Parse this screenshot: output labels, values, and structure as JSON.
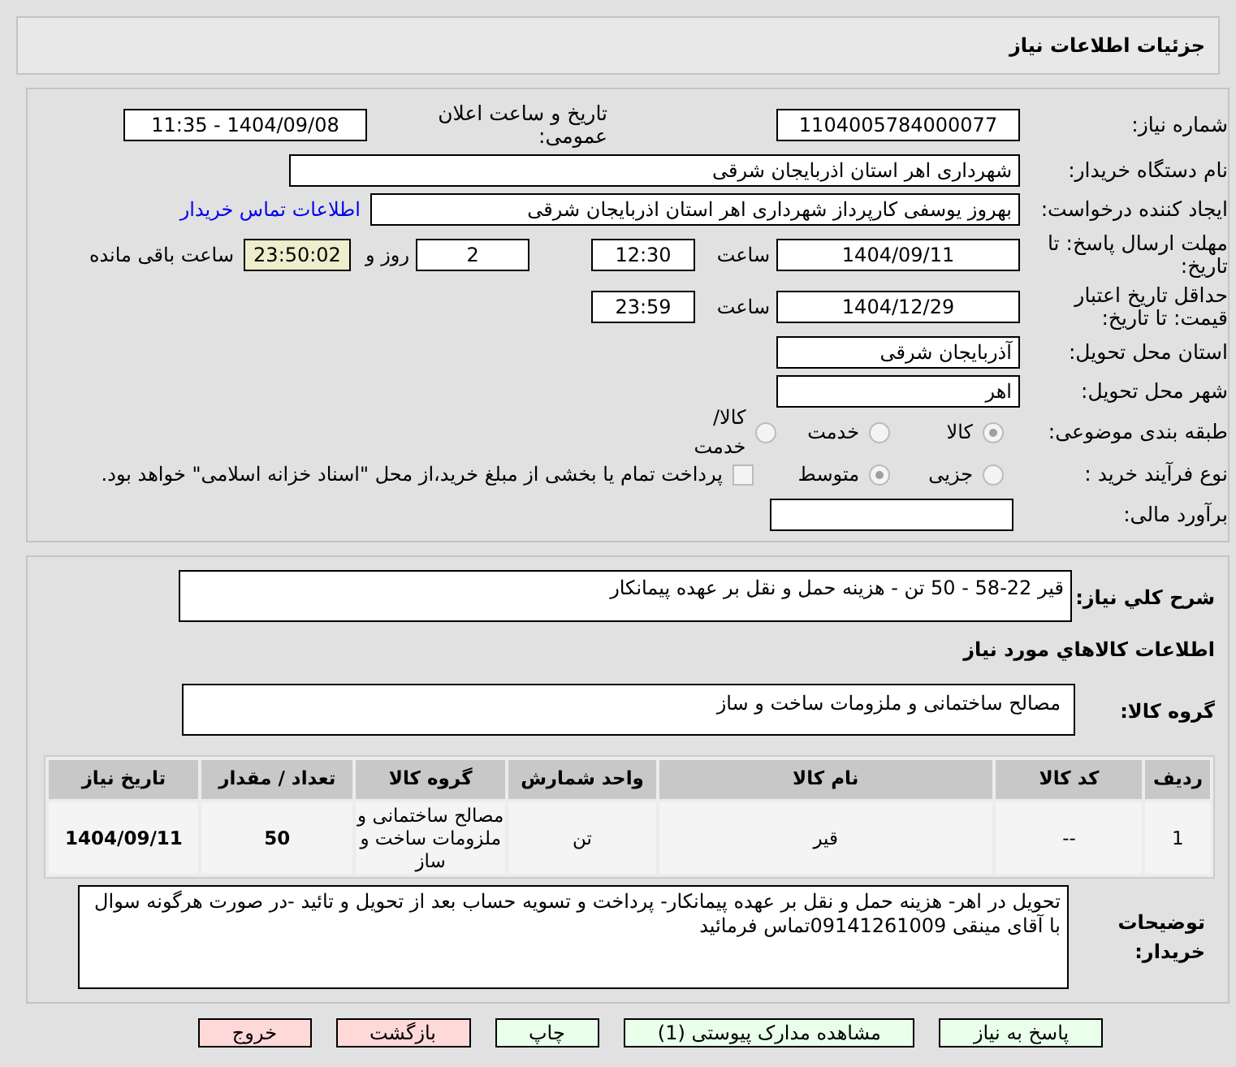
{
  "title": "جزئیات اطلاعات نیاز",
  "need_number": {
    "label": "شماره نیاز:",
    "value": "1104005784000077"
  },
  "announce": {
    "label": "تاریخ و ساعت اعلان عمومی:",
    "value": "1404/09/08 - 11:35"
  },
  "buyer": {
    "label": "نام دستگاه خریدار:",
    "value": "شهرداری اهر استان اذربایجان شرقی"
  },
  "creator": {
    "label": "ایجاد کننده درخواست:",
    "value": "بهروز یوسفی کارپرداز شهرداری اهر استان اذربایجان شرقی",
    "link": "اطلاعات تماس خریدار"
  },
  "deadline": {
    "label": "مهلت ارسال پاسخ: تا تاریخ:",
    "date": "1404/09/11",
    "time_label": "ساعت",
    "time": "12:30",
    "days": "2",
    "days_label": "روز و",
    "remaining": "23:50:02",
    "remaining_label": "ساعت باقی مانده"
  },
  "validity": {
    "label": "حداقل تاریخ اعتبار قیمت: تا تاریخ:",
    "date": "1404/12/29",
    "time_label": "ساعت",
    "time": "23:59"
  },
  "province": {
    "label": "استان محل تحویل:",
    "value": "آذربایجان شرقی"
  },
  "city": {
    "label": "شهر محل تحویل:",
    "value": "اهر"
  },
  "category": {
    "label": "طبقه بندی موضوعی:",
    "options": [
      {
        "label": "کالا",
        "selected": true
      },
      {
        "label": "خدمت",
        "selected": false
      },
      {
        "label": "کالا/خدمت",
        "selected": false
      }
    ]
  },
  "process": {
    "label": "نوع فرآیند خرید :",
    "options": [
      {
        "label": "جزیی",
        "selected": false
      },
      {
        "label": "متوسط",
        "selected": true
      }
    ],
    "payment": {
      "label": "پرداخت تمام یا بخشی از مبلغ خرید،از محل \"اسناد خزانه اسلامی\" خواهد بود.",
      "checked": false
    }
  },
  "estimate": {
    "label": "برآورد مالی:"
  },
  "description": {
    "label": "شرح کلي نیاز:",
    "value": "قیر 22-58 - 50 تن - هزینه حمل و نقل بر عهده پیمانکار"
  },
  "goods_heading": "اطلاعات کالاهاي مورد نياز",
  "goods_group": {
    "label": "گروه کالا:",
    "value": "مصالح ساختمانی و ملزومات ساخت و ساز"
  },
  "table": {
    "columns": [
      "ردیف",
      "کد کالا",
      "نام کالا",
      "واحد شمارش",
      "گروه کالا",
      "تعداد / مقدار",
      "تاریخ نیاز"
    ],
    "rows": [
      [
        "1",
        "--",
        "قیر",
        "تن",
        "مصالح ساختمانی و ملزومات ساخت و ساز",
        "50",
        "1404/09/11"
      ]
    ]
  },
  "notes": {
    "label": "توضیحات خریدار:",
    "value": "تحویل در اهر- هزینه حمل و نقل بر عهده پیمانکار- پرداخت و تسویه حساب بعد از تحویل و تائید -در صورت هرگونه سوال با آقای مینقی 09141261009تماس فرمائید"
  },
  "buttons": [
    {
      "label": "پاسخ به نیاز",
      "kind": "primary"
    },
    {
      "label": "مشاهده مدارک پیوستی (1)",
      "kind": "primary"
    },
    {
      "label": "چاپ",
      "kind": "primary"
    },
    {
      "label": "بازگشت",
      "kind": "danger"
    },
    {
      "label": "خروج",
      "kind": "danger"
    }
  ]
}
